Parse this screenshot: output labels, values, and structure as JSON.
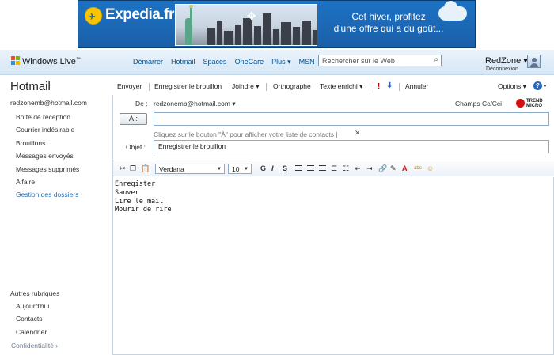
{
  "ad": {
    "brand": "Expedia.fr",
    "headline_line1": "Cet hiver, profitez",
    "headline_line2": "d'une offre qui a du goût..."
  },
  "topnav": {
    "brand": "Windows Live",
    "brand_mark": "™",
    "links": [
      "Démarrer",
      "Hotmail",
      "Spaces",
      "OneCare",
      "Plus ▾",
      "MSN"
    ],
    "search_placeholder": "Rechercher sur le Web",
    "profile_name": "RedZone ▾",
    "profile_logout": "Déconnexion"
  },
  "sidebar": {
    "title": "Hotmail",
    "account": "redzonemb@hotmail.com",
    "folders": [
      {
        "label": "Boîte de réception",
        "link": false
      },
      {
        "label": "Courrier indésirable",
        "link": false
      },
      {
        "label": "Brouillons",
        "link": false
      },
      {
        "label": "Messages envoyés",
        "link": false
      },
      {
        "label": "Messages supprimés",
        "link": false
      },
      {
        "label": "A faire",
        "link": false
      },
      {
        "label": "Gestion des dossiers",
        "link": true
      }
    ],
    "other_title": "Autres rubriques",
    "other": [
      "Aujourd'hui",
      "Contacts",
      "Calendrier"
    ],
    "privacy": "Confidentialité ›"
  },
  "toolbar": {
    "send": "Envoyer",
    "save_draft": "Enregistrer le brouillon",
    "attach": "Joindre ▾",
    "spelling": "Orthographe",
    "rich_text": "Texte enrichi ▾",
    "priority_high": "!",
    "priority_low": "⬇",
    "cancel": "Annuler",
    "options": "Options ▾",
    "help": "?",
    "help_caret": "▾"
  },
  "compose": {
    "from_label": "De :",
    "from_value": "redzonemb@hotmail.com ▾",
    "cc_link": "Champs Cc/Cci",
    "trend_line1": "TREND",
    "trend_line2": "MICRO",
    "to_button": "À :",
    "to_value": "",
    "hint": "Cliquez sur le bouton \"À\" pour afficher votre liste de contacts  |",
    "hint_close": "✕",
    "subject_label": "Objet :",
    "subject_value": "Enregistrer le brouillon"
  },
  "format": {
    "font": "Verdana",
    "size": "10",
    "caret": "▼",
    "bold": "G",
    "italic": "I",
    "underline": "S"
  },
  "body": {
    "lines": [
      "Enregister",
      "Sauver",
      "Lire le mail",
      "Mourir de rire"
    ]
  },
  "colors": {
    "link": "#04518c",
    "folder_link": "#2f6fb0",
    "banner": "#1d72c4",
    "field_border": "#8faac6"
  }
}
